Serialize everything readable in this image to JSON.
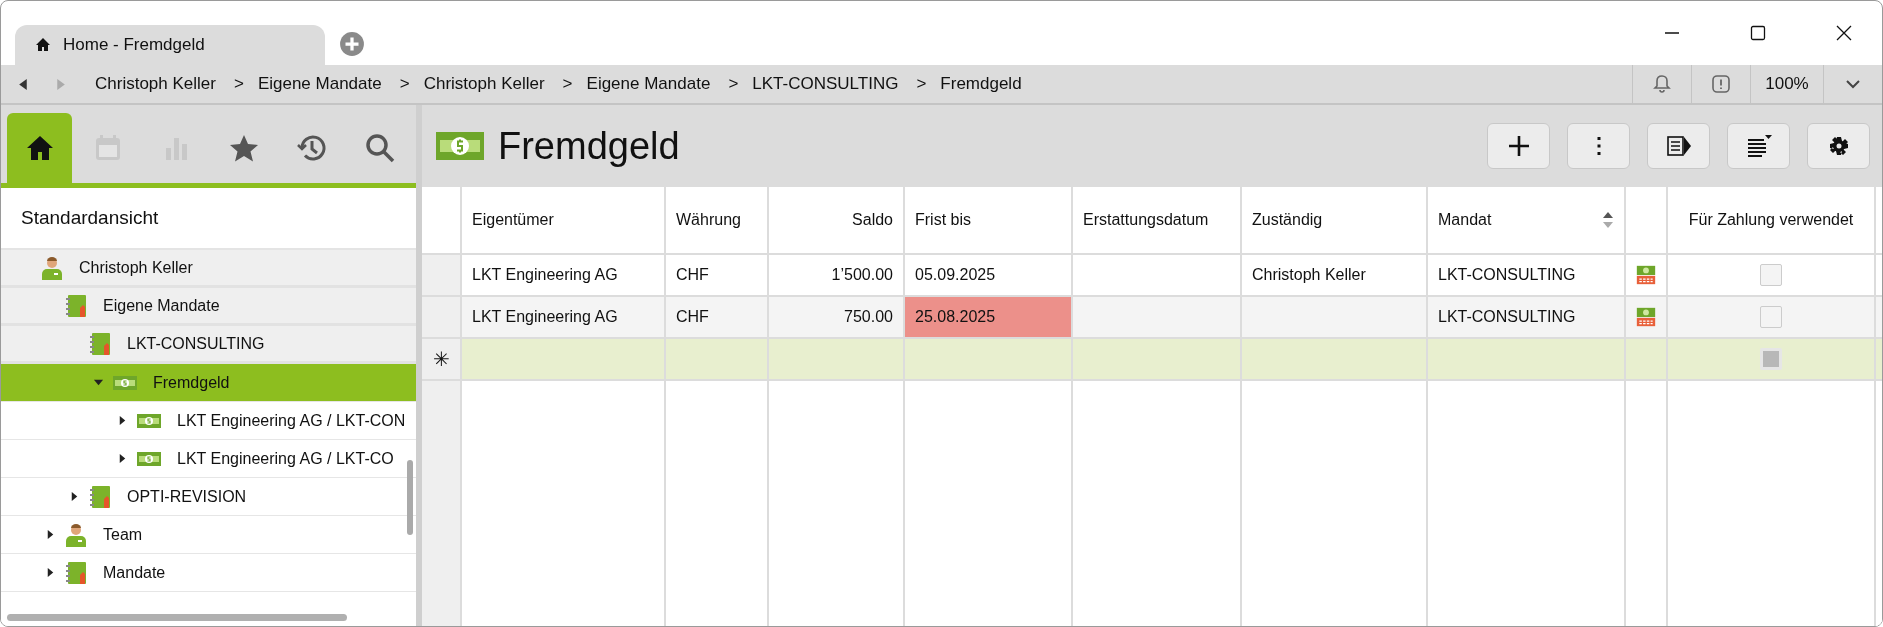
{
  "window": {
    "tab_title": "Home - Fremdgeld"
  },
  "nav": {
    "breadcrumbs": [
      "Christoph Keller",
      "Eigene Mandate",
      "Christoph Keller",
      "Eigene Mandate",
      "LKT-CONSULTING",
      "Fremdgeld"
    ],
    "separator": ">",
    "zoom": "100%"
  },
  "sidebar": {
    "tabs": [
      {
        "kind": "home",
        "selected": true,
        "disabled": false
      },
      {
        "kind": "calendar",
        "selected": false,
        "disabled": true
      },
      {
        "kind": "chart",
        "selected": false,
        "disabled": true
      },
      {
        "kind": "star",
        "selected": false,
        "disabled": false
      },
      {
        "kind": "history",
        "selected": false,
        "disabled": false
      },
      {
        "kind": "search",
        "selected": false,
        "disabled": false
      }
    ],
    "view_title": "Standardansicht",
    "tree": [
      {
        "label": "Christoph Keller",
        "kind": "person",
        "pinned": true,
        "selected": false,
        "children": [
          {
            "label": "Eigene Mandate",
            "kind": "folder",
            "pinned": true,
            "selected": false,
            "children": [
              {
                "label": "LKT-CONSULTING",
                "kind": "folder",
                "pinned": true,
                "selected": false,
                "children": [
                  {
                    "label": "Fremdgeld",
                    "kind": "money",
                    "pinned": false,
                    "expanded": true,
                    "selected": true,
                    "children": [
                      {
                        "label": "LKT Engineering AG / LKT-CON",
                        "kind": "money",
                        "pinned": false,
                        "expanded": false,
                        "selected": false
                      },
                      {
                        "label": "LKT Engineering AG / LKT-CO",
                        "kind": "money",
                        "pinned": false,
                        "expanded": false,
                        "selected": false
                      }
                    ]
                  }
                ]
              },
              {
                "label": "OPTI-REVISION",
                "kind": "folder",
                "pinned": false,
                "expanded": false,
                "selected": false
              }
            ]
          },
          {
            "label": "Team",
            "kind": "person",
            "pinned": false,
            "expanded": false,
            "selected": false
          },
          {
            "label": "Mandate",
            "kind": "folder",
            "pinned": false,
            "expanded": false,
            "selected": false
          }
        ]
      }
    ]
  },
  "page": {
    "title": "Fremdgeld",
    "toolbar": [
      {
        "kind": "add"
      },
      {
        "kind": "more"
      },
      {
        "kind": "panel"
      },
      {
        "kind": "sort"
      },
      {
        "kind": "settings"
      }
    ]
  },
  "table": {
    "columns": [
      {
        "kind": "text",
        "label": "Eigentümer",
        "sortable": false
      },
      {
        "kind": "text",
        "label": "Währung",
        "sortable": false
      },
      {
        "kind": "number",
        "label": "Saldo",
        "sortable": false
      },
      {
        "kind": "text",
        "label": "Frist bis",
        "sortable": false
      },
      {
        "kind": "text",
        "label": "Erstattungsdatum",
        "sortable": false
      },
      {
        "kind": "text",
        "label": "Zuständig",
        "sortable": false
      },
      {
        "kind": "text",
        "label": "Mandat",
        "sortable": true
      },
      {
        "kind": "icon",
        "sortable": false
      },
      {
        "kind": "check",
        "label": "Für Zahlung verwendet",
        "sortable": false
      }
    ],
    "rows": [
      {
        "kind": "data",
        "cells": [
          "LKT Engineering AG",
          "CHF",
          "1’500.00",
          "05.09.2025",
          null,
          "Christoph Keller",
          "LKT-CONSULTING"
        ],
        "overdue": false,
        "checked": false,
        "disabled": false
      },
      {
        "kind": "data",
        "cells": [
          "LKT Engineering AG",
          "CHF",
          "750.00",
          "25.08.2025",
          null,
          null,
          "LKT-CONSULTING"
        ],
        "overdue": true,
        "checked": false,
        "disabled": false
      },
      {
        "kind": "new",
        "marker": "✳",
        "checked": false,
        "disabled": true
      }
    ]
  }
}
